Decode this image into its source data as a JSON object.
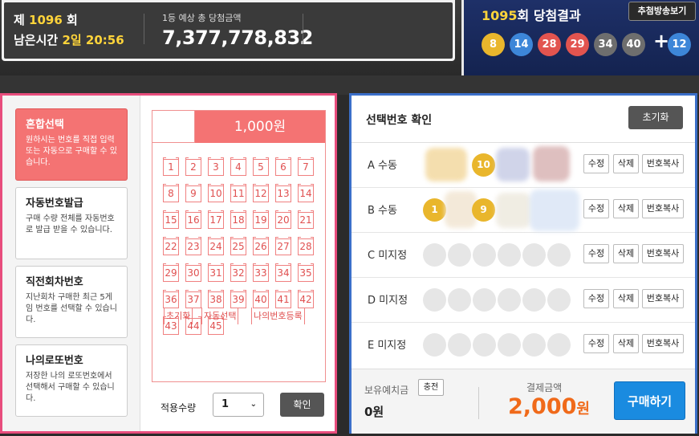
{
  "header": {
    "draw_prefix": "제",
    "draw_no": "1096",
    "draw_suffix": "회",
    "remain_label": "남은시간",
    "remain_value": "2일 20:56",
    "prize_label": "1등 예상 총 당첨금액",
    "prize_amount": "7,377,778,832"
  },
  "last_result": {
    "round": "1095",
    "title_suffix": "회 당첨결과",
    "replay_button": "추첨방송보기",
    "balls": [
      "8",
      "14",
      "28",
      "29",
      "34",
      "40"
    ],
    "bonus": "12",
    "colors": {
      "yellow": "#e9b62c",
      "blue": "#3d86d8",
      "red": "#e2544f",
      "gray": "#6e6e6e",
      "green": "#7ab33d"
    }
  },
  "tabs": [
    {
      "title": "혼합선택",
      "desc": "원하시는 번호를 직접 입력 또는 자동으로 구매할 수 있습니다."
    },
    {
      "title": "자동번호발급",
      "desc": "구매 수량 전체를 자동번호로 발급 받을 수 있습니다."
    },
    {
      "title": "직전회차번호",
      "desc": "지난회차 구매한 최근 5게임 번호를 선택할 수 있습니다."
    },
    {
      "title": "나의로또번호",
      "desc": "저장한 나의 로또번호에서 선택해서 구매할 수 있습니다."
    }
  ],
  "slip": {
    "price": "1,000원",
    "numbers": [
      "1",
      "2",
      "3",
      "4",
      "5",
      "6",
      "7",
      "8",
      "9",
      "10",
      "11",
      "12",
      "13",
      "14",
      "15",
      "16",
      "17",
      "18",
      "19",
      "20",
      "21",
      "22",
      "23",
      "24",
      "25",
      "26",
      "27",
      "28",
      "29",
      "30",
      "31",
      "32",
      "33",
      "34",
      "35",
      "36",
      "37",
      "38",
      "39",
      "40",
      "41",
      "42",
      "43",
      "44",
      "45"
    ],
    "buttons": [
      "초기화",
      "자동선택",
      "나의번호등록"
    ]
  },
  "quantity": {
    "label": "적용수량",
    "value": "1",
    "confirm": "확인"
  },
  "selection": {
    "title": "선택번호 확인",
    "reset": "초기화",
    "rows": [
      {
        "label": "A 수동",
        "balls": [
          "",
          "10",
          "",
          ""
        ]
      },
      {
        "label": "B 수동",
        "balls": [
          "1",
          "",
          "9",
          ""
        ]
      },
      {
        "label": "C 미지정"
      },
      {
        "label": "D 미지정"
      },
      {
        "label": "E 미지정"
      }
    ],
    "row_buttons": [
      "수정",
      "삭제",
      "번호복사"
    ]
  },
  "footer": {
    "balance_label": "보유예치금",
    "charge": "충전",
    "balance": "0원",
    "pay_label": "결제금액",
    "pay_amount": "2,000",
    "pay_unit": "원",
    "buy": "구매하기"
  }
}
